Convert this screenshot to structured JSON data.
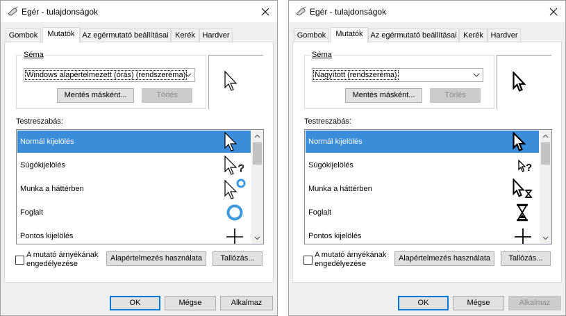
{
  "windows": [
    {
      "title": "Egér - tulajdonságok",
      "tabs": [
        "Gombok",
        "Mutatók",
        "Az egérmutató beállításai",
        "Kerék",
        "Hardver"
      ],
      "active_tab": "Mutatók",
      "scheme_group_label": "Séma",
      "scheme_value": "Windows alapértelmezett (órás) (rendszeréma)",
      "save_as_label": "Mentés másként...",
      "delete_label": "Törlés",
      "customize_label": "Testreszabás:",
      "cursor_items": [
        {
          "label": "Normál kijelölés",
          "icon": "arrow-cursor-icon",
          "selected": true
        },
        {
          "label": "Súgókijelölés",
          "icon": "help-cursor-icon",
          "selected": false
        },
        {
          "label": "Munka a háttérben",
          "icon": "working-cursor-icon",
          "selected": false
        },
        {
          "label": "Foglalt",
          "icon": "busy-ring-icon",
          "selected": false
        },
        {
          "label": "Pontos kijelölés",
          "icon": "crosshair-icon",
          "selected": false
        }
      ],
      "shadow_checkbox_label": "A mutató árnyékának engedélyezése",
      "shadow_checked": false,
      "use_default_label": "Alapértelmezés használata",
      "browse_label": "Tallózás...",
      "ok_label": "OK",
      "cancel_label": "Mégse",
      "apply_label": "Alkalmaz",
      "apply_enabled": true
    },
    {
      "title": "Egér - tulajdonságok",
      "tabs": [
        "Gombok",
        "Mutatók",
        "Az egérmutató beállításai",
        "Kerék",
        "Hardver"
      ],
      "active_tab": "Mutatók",
      "scheme_group_label": "Séma",
      "scheme_value": "Nagyított (rendszeréma)",
      "save_as_label": "Mentés másként...",
      "delete_label": "Törlés",
      "customize_label": "Testreszabás:",
      "cursor_items": [
        {
          "label": "Normál kijelölés",
          "icon": "arrow-cursor-icon",
          "selected": true
        },
        {
          "label": "Súgókijelölés",
          "icon": "help-cursor-icon",
          "selected": false
        },
        {
          "label": "Munka a háttérben",
          "icon": "working-hourglass-cursor-icon",
          "selected": false
        },
        {
          "label": "Foglalt",
          "icon": "hourglass-icon",
          "selected": false
        },
        {
          "label": "Pontos kijelölés",
          "icon": "crosshair-icon",
          "selected": false
        }
      ],
      "shadow_checkbox_label": "A mutató árnyékának engedélyezése",
      "shadow_checked": false,
      "use_default_label": "Alapértelmezés használata",
      "browse_label": "Tallózás...",
      "ok_label": "OK",
      "cancel_label": "Mégse",
      "apply_label": "Alkalmaz",
      "apply_enabled": false
    }
  ],
  "colors": {
    "selection": "#3c8dd9",
    "focus_blue": "#0078d7",
    "busy_ring": "#3c9be0",
    "dialog_bg": "#f0f0f0"
  }
}
